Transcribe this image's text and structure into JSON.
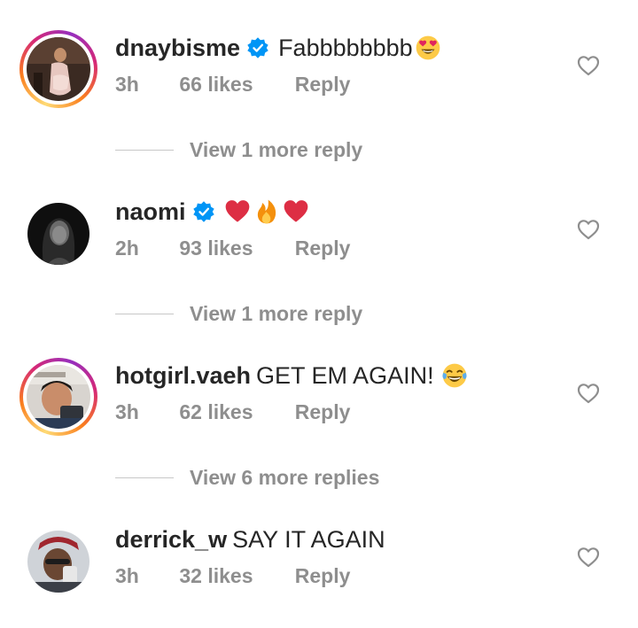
{
  "comments": [
    {
      "username": "dnaybisme",
      "verified": true,
      "has_story": true,
      "text": "Fabbbbbbbb",
      "emoji": [
        "heart-eyes-emoji"
      ],
      "time": "3h",
      "likes": "66 likes",
      "reply_label": "Reply",
      "more_replies": "View 1 more reply"
    },
    {
      "username": "naomi",
      "verified": true,
      "has_story": false,
      "text": "",
      "emoji": [
        "red-heart-emoji",
        "fire-emoji",
        "red-heart-emoji"
      ],
      "time": "2h",
      "likes": "93 likes",
      "reply_label": "Reply",
      "more_replies": "View 1 more reply"
    },
    {
      "username": "hotgirl.vaeh",
      "verified": false,
      "has_story": true,
      "text": "GET EM AGAIN!",
      "emoji": [
        "tears-of-joy-emoji"
      ],
      "time": "3h",
      "likes": "62 likes",
      "reply_label": "Reply",
      "more_replies": "View 6 more replies"
    },
    {
      "username": "derrick_w",
      "verified": false,
      "has_story": false,
      "text": "SAY IT AGAIN",
      "emoji": [],
      "time": "3h",
      "likes": "32 likes",
      "reply_label": "Reply"
    }
  ],
  "colors": {
    "text": "#262626",
    "secondary": "#8e8e8e",
    "verified_blue": "#0095f6",
    "divider": "#c7c7c7"
  },
  "icons": {
    "like": "heart-outline-icon",
    "verified": "verified-badge-icon"
  }
}
